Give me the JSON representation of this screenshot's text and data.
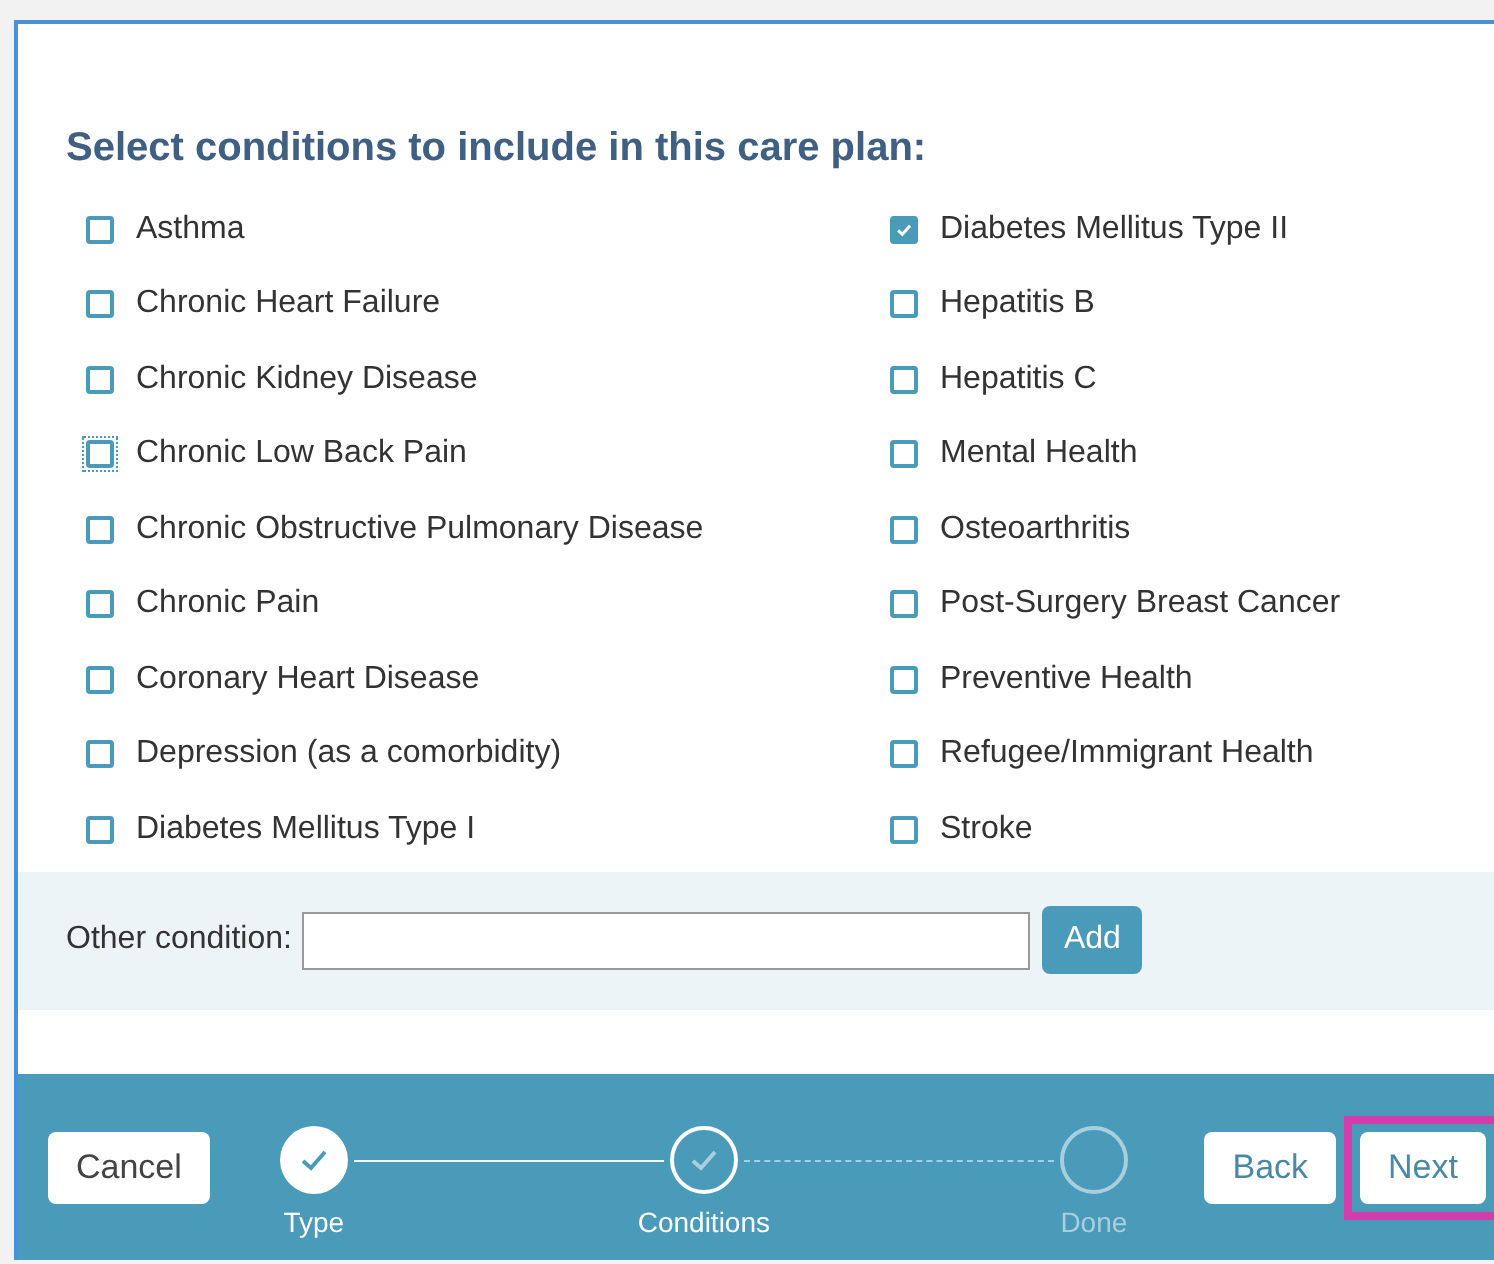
{
  "heading": "Select conditions to include in this care plan:",
  "columns": [
    [
      {
        "label": "Asthma",
        "checked": false,
        "focused": false
      },
      {
        "label": "Chronic Heart Failure",
        "checked": false,
        "focused": false
      },
      {
        "label": "Chronic Kidney Disease",
        "checked": false,
        "focused": false
      },
      {
        "label": "Chronic Low Back Pain",
        "checked": false,
        "focused": true
      },
      {
        "label": "Chronic Obstructive Pulmonary Disease",
        "checked": false,
        "focused": false
      },
      {
        "label": "Chronic Pain",
        "checked": false,
        "focused": false
      },
      {
        "label": "Coronary Heart Disease",
        "checked": false,
        "focused": false
      },
      {
        "label": "Depression (as a comorbidity)",
        "checked": false,
        "focused": false
      },
      {
        "label": "Diabetes Mellitus Type I",
        "checked": false,
        "focused": false
      }
    ],
    [
      {
        "label": "Diabetes Mellitus Type II",
        "checked": true,
        "focused": false
      },
      {
        "label": "Hepatitis B",
        "checked": false,
        "focused": false
      },
      {
        "label": "Hepatitis C",
        "checked": false,
        "focused": false
      },
      {
        "label": "Mental Health",
        "checked": false,
        "focused": false
      },
      {
        "label": "Osteoarthritis",
        "checked": false,
        "focused": false
      },
      {
        "label": "Post-Surgery Breast Cancer",
        "checked": false,
        "focused": false
      },
      {
        "label": "Preventive Health",
        "checked": false,
        "focused": false
      },
      {
        "label": "Refugee/Immigrant Health",
        "checked": false,
        "focused": false
      },
      {
        "label": "Stroke",
        "checked": false,
        "focused": false
      }
    ]
  ],
  "other_condition": {
    "label": "Other condition:",
    "button": "Add"
  },
  "footer": {
    "cancel": "Cancel",
    "steps": [
      {
        "label": "Type",
        "kind": "completed"
      },
      {
        "label": "Conditions",
        "kind": "current"
      },
      {
        "label": "Done",
        "kind": "upcoming"
      }
    ],
    "back": "Back",
    "next": {
      "label": "Next",
      "highlighted": true
    }
  }
}
